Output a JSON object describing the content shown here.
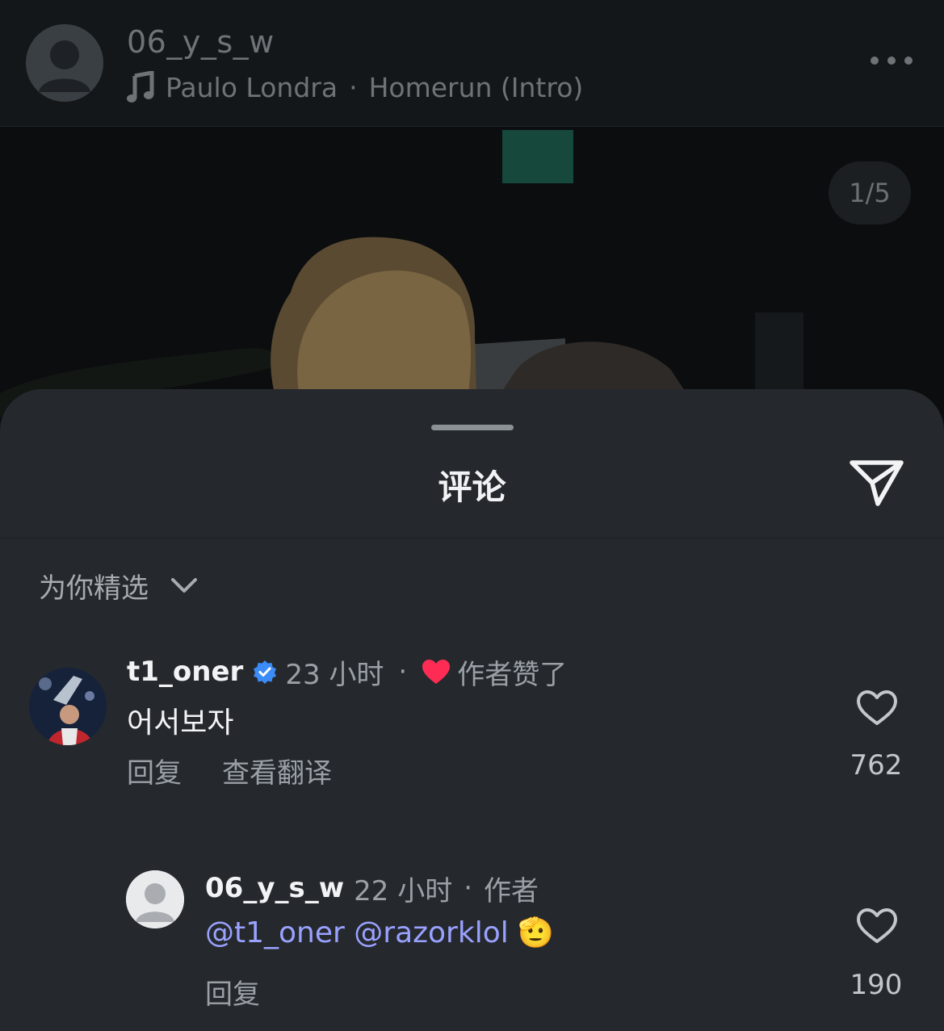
{
  "post": {
    "username": "06_y_s_w",
    "music_artist": "Paulo Londra",
    "music_separator": "·",
    "music_title": "Homerun (Intro)",
    "image_counter": "1/5"
  },
  "sheet": {
    "title": "评论",
    "sort_label": "为你精选"
  },
  "comments": [
    {
      "username": "t1_oner",
      "verified": true,
      "time": "23 小时",
      "separator": "·",
      "liked_by_author": "作者赞了",
      "text": "어서보자",
      "reply_label": "回复",
      "translate_label": "查看翻译",
      "likes": "762"
    },
    {
      "username": "06_y_s_w",
      "time": "22 小时",
      "separator": "·",
      "author_tag": "作者",
      "mention1": "@t1_oner",
      "mention2": "@razorklol",
      "emoji": "🫡",
      "reply_label": "回复",
      "likes": "190"
    }
  ],
  "colors": {
    "heart": "#fe2c55",
    "verified": "#3b8cf6",
    "mention": "#9aa2ff",
    "sheet_bg": "#25292e"
  }
}
